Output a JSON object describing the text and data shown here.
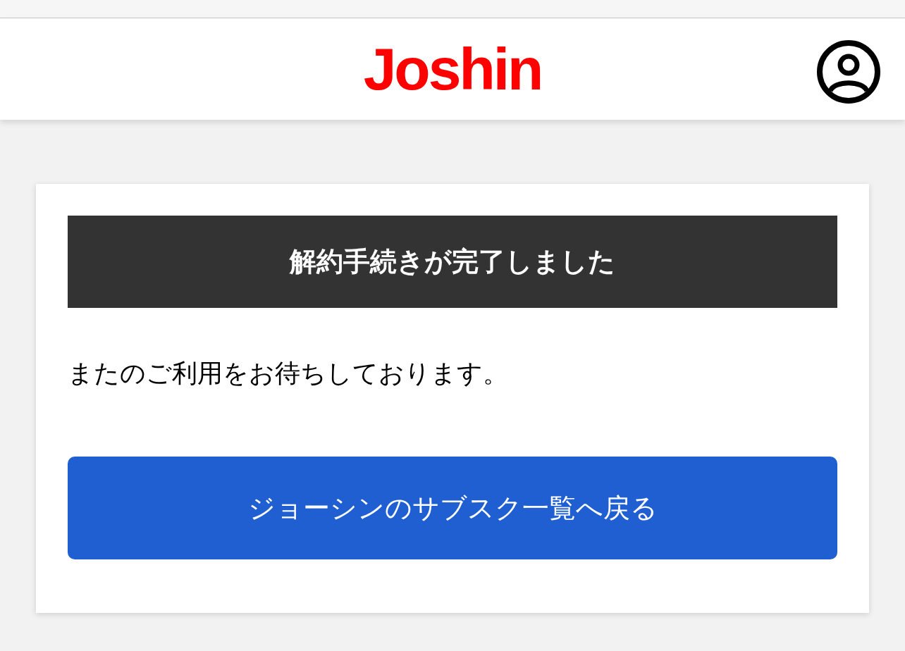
{
  "header": {
    "logo": "Joshin"
  },
  "card": {
    "title": "解約手続きが完了しました",
    "message": "またのご利用をお待ちしております。",
    "button": "ジョーシンのサブスク一覧へ戻る"
  }
}
